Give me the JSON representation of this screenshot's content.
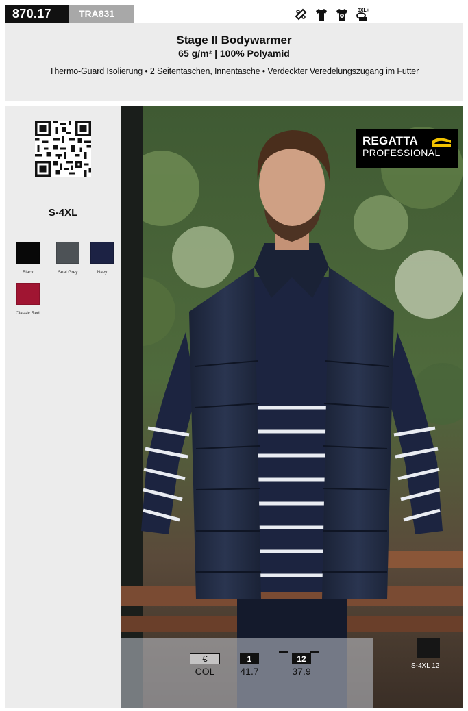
{
  "top_bar": {
    "article_number": "870.17",
    "manufacturer_code": "TRA831",
    "feature_icons": [
      "no-ironing-icon",
      "tshirt-icon",
      "tshirt-print-icon",
      "extended-sizes-icon"
    ],
    "extended_sizes_label": "3XL+"
  },
  "product": {
    "name": "Stage II Bodywarmer",
    "specs": "65 g/m² | 100% Polyamid",
    "features": "Thermo-Guard Isolierung • 2 Seitentaschen, Innentasche • Verdeckter Veredelungszugang im Futter"
  },
  "sizes": {
    "range": "S-4XL"
  },
  "colors": [
    {
      "name": "Black",
      "hex": "#080808"
    },
    {
      "name": "Seal Grey",
      "hex": "#4d5256"
    },
    {
      "name": "Navy",
      "hex": "#1c2244"
    },
    {
      "name": "Classic Red",
      "hex": "#a01532"
    }
  ],
  "brand": {
    "line1": "REGATTA",
    "line2": "PROFESSIONAL",
    "accent": "#f2c200"
  },
  "pricing": {
    "currency_symbol": "€",
    "color_label": "COL",
    "tiers": [
      {
        "qty": "1",
        "price": "41.7"
      },
      {
        "qty": "12",
        "price": "37.9"
      }
    ]
  },
  "carton": {
    "text": "S-4XL 12"
  }
}
